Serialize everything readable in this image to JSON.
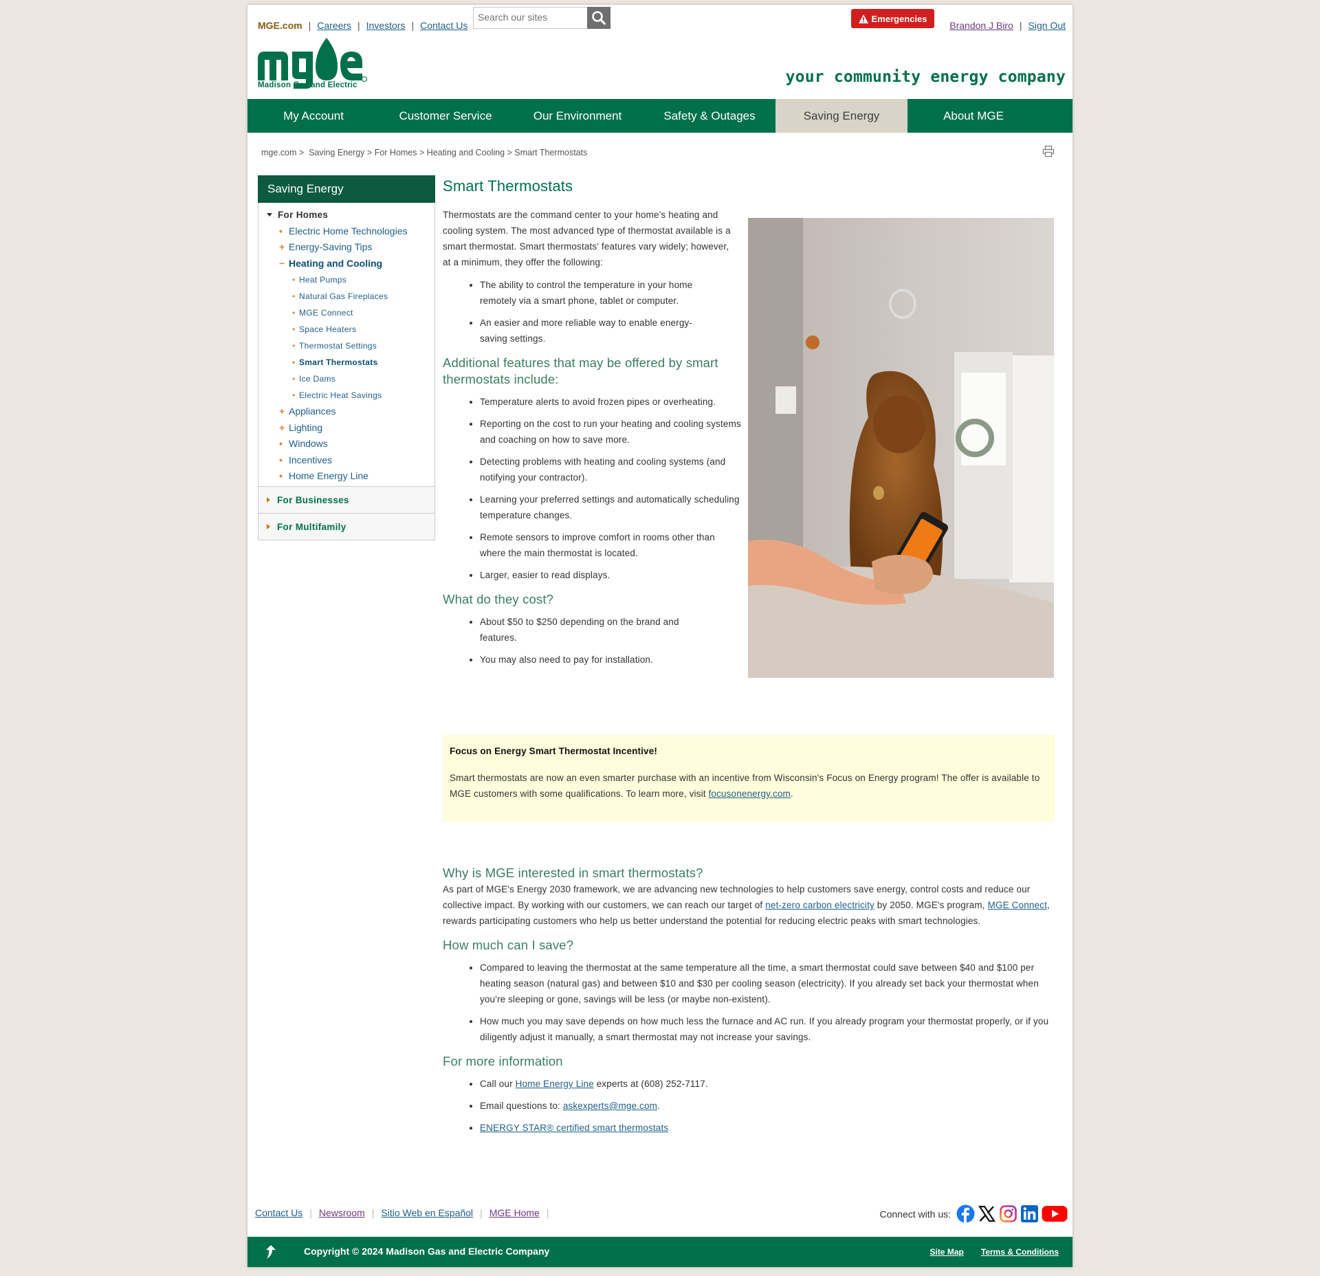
{
  "utility": {
    "brand": "MGE.com",
    "links": [
      "Careers",
      "Investors",
      "Contact Us"
    ],
    "search_placeholder": "Search our sites",
    "emergencies": "Emergencies",
    "user_name": "Brandon J Biro",
    "sign_out": "Sign Out"
  },
  "logo": {
    "text": "mge",
    "sub": "Madison Gas and Electric"
  },
  "tagline": "your community energy company",
  "nav": [
    "My Account",
    "Customer Service",
    "Our Environment",
    "Safety & Outages",
    "Saving Energy",
    "About MGE"
  ],
  "breadcrumb": [
    "mge.com",
    "Saving Energy",
    "For Homes",
    "Heating and Cooling",
    "Smart Thermostats"
  ],
  "sidebar": {
    "title": "Saving Energy",
    "section": "For Homes",
    "items": [
      {
        "label": "Electric Home Technologies",
        "bullet": "•"
      },
      {
        "label": "Energy-Saving Tips",
        "bullet": "+"
      },
      {
        "label": "Heating and Cooling",
        "bullet": "−"
      }
    ],
    "subitems": [
      "Heat Pumps",
      "Natural Gas Fireplaces",
      "MGE Connect",
      "Space Heaters",
      "Thermostat Settings",
      "Smart Thermostats",
      "Ice Dams",
      "Electric Heat Savings"
    ],
    "items2": [
      {
        "label": "Appliances",
        "bullet": "+"
      },
      {
        "label": "Lighting",
        "bullet": "+"
      },
      {
        "label": "Windows",
        "bullet": "•"
      },
      {
        "label": "Incentives",
        "bullet": "•"
      },
      {
        "label": "Home Energy Line",
        "bullet": "•"
      }
    ],
    "other_sections": [
      "For Businesses",
      "For Multifamily"
    ]
  },
  "content": {
    "title": "Smart Thermostats",
    "intro": "Thermostats are the command center to your home's heating and cooling system. The most advanced type of thermostat available is a smart thermostat. Smart thermostats' features vary widely; however, at a minimum, they offer the following:",
    "intro_list": [
      "The ability to control the temperature in your home remotely via a smart phone, tablet or computer.",
      "An easier and more reliable way to enable energy-saving settings."
    ],
    "features_heading": "Additional features that may be offered by smart thermostats include:",
    "features_list": [
      "Temperature alerts to avoid frozen pipes or overheating.",
      "Reporting on the cost to run your heating and cooling systems and coaching on how to save more.",
      "Detecting problems with heating and cooling systems (and notifying your contractor).",
      "Learning your preferred settings and automatically scheduling temperature changes.",
      "Remote sensors to improve comfort in rooms other than where the main thermostat is located.",
      "Larger, easier to read displays."
    ],
    "cost_heading": "What do they cost?",
    "cost_list": [
      "About $50 to $250 depending on the brand and features.",
      "You may also need to pay for installation."
    ],
    "callout_title": "Focus on Energy Smart Thermostat Incentive!",
    "callout_text": "Smart thermostats are now an even smarter purchase with an incentive from Wisconsin's Focus on Energy program!  The offer is available to MGE customers with some qualifications. To learn more, visit ",
    "callout_link": "focusonenergy.com",
    "callout_end": ".",
    "why_heading": "Why is MGE interested in smart thermostats?",
    "why_1": "As part of MGE's Energy 2030 framework, we are advancing new technologies to help customers save energy, control costs and reduce our collective impact. By working with our customers, we can reach our target of ",
    "why_link1": "net-zero carbon electricity",
    "why_2": " by 2050. MGE's program, ",
    "why_link2": "MGE Connect",
    "why_3": ", rewards participating customers who help us better understand the potential for reducing electric peaks with smart technologies.",
    "save_heading": "How much can I save?",
    "save_list": [
      "Compared to leaving the thermostat at the same temperature all the time, a smart thermostat could save between $40 and $100 per heating season (natural gas) and between $10 and $30 per cooling season (electricity). If you already set back your thermostat when you're sleeping or gone, savings will be less (or maybe non-existent).",
      "How much you may save depends on how much less the furnace and AC run. If you already program your thermostat properly, or if you diligently adjust it manually, a smart thermostat may not increase your savings."
    ],
    "more_heading": "For more information",
    "more_1a": "Call our ",
    "more_1link": "Home Energy Line",
    "more_1b": " experts at (608) 252-7117.",
    "more_2a": "Email questions to: ",
    "more_2link": "askexperts@mge.com",
    "more_2b": ".",
    "more_3link": "ENERGY STAR® certified smart thermostats"
  },
  "footer": {
    "links": [
      "Contact Us",
      "Newsroom",
      "Sitio Web en Español",
      "MGE Home"
    ],
    "connect": "Connect with us:",
    "copyright": "Copyright © 2024 Madison Gas and Electric Company",
    "right_links": [
      "Site Map",
      "Terms & Conditions"
    ]
  },
  "colors": {
    "brand_green": "#00704a",
    "active_nav": "#d8d4c7",
    "emergency_red": "#d11f1f",
    "callout_bg": "#fefddc",
    "link_blue": "#1f5e89"
  }
}
